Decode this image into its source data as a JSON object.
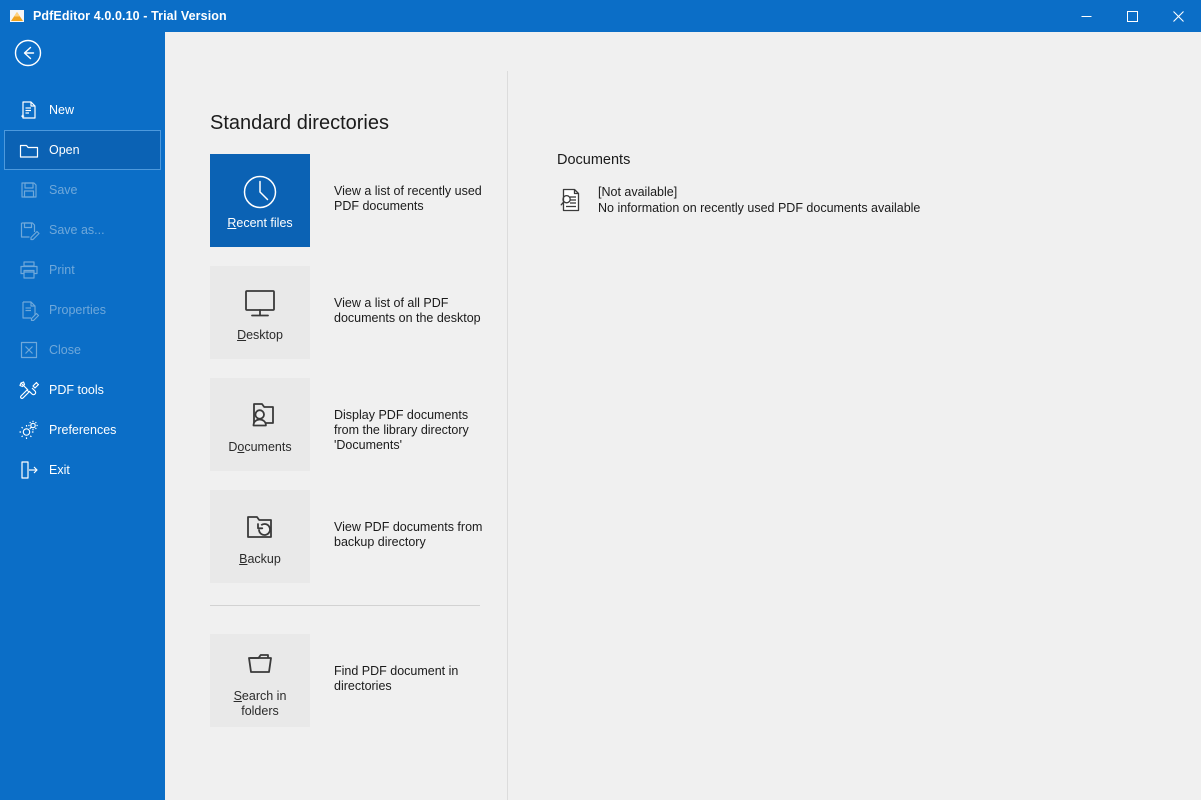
{
  "window": {
    "title": "PdfEditor 4.0.0.10 - Trial Version",
    "app_icon": "pdfeditor-logo-icon",
    "accent_color": "#0b6ec7",
    "controls": [
      {
        "name": "minimize-button",
        "glyph": "—"
      },
      {
        "name": "maximize-button",
        "glyph": "□"
      },
      {
        "name": "close-button",
        "glyph": "✕"
      }
    ]
  },
  "sidebar": {
    "back_label": "Back",
    "back_icon": "back-arrow-circle-icon",
    "items": [
      {
        "label": "New",
        "icon": "new-document-icon",
        "state": "enabled"
      },
      {
        "label": "Open",
        "icon": "open-folder-icon",
        "state": "selected"
      },
      {
        "label": "Save",
        "icon": "save-disk-icon",
        "state": "disabled"
      },
      {
        "label": "Save as...",
        "icon": "save-as-icon",
        "state": "disabled"
      },
      {
        "label": "Print",
        "icon": "printer-icon",
        "state": "disabled"
      },
      {
        "label": "Properties",
        "icon": "properties-icon",
        "state": "disabled"
      },
      {
        "label": "Close",
        "icon": "close-box-icon",
        "state": "disabled"
      },
      {
        "label": "PDF tools",
        "icon": "tools-icon",
        "state": "enabled"
      },
      {
        "label": "Preferences",
        "icon": "gears-icon",
        "state": "enabled"
      },
      {
        "label": "Exit",
        "icon": "exit-door-icon",
        "state": "enabled"
      }
    ]
  },
  "main": {
    "heading": "Standard directories",
    "tiles": [
      {
        "label": "Recent files",
        "accel": "R",
        "icon": "clock-icon",
        "selected": true,
        "description": "View a list of recently used\nPDF documents"
      },
      {
        "label": "Desktop",
        "accel": "D",
        "icon": "monitor-icon",
        "selected": false,
        "description": "View a list of all PDF\ndocuments on the desktop"
      },
      {
        "label": "Documents",
        "accel": "o",
        "icon": "folder-user-icon",
        "selected": false,
        "description": "Display PDF documents\nfrom the library directory\n'Documents'"
      },
      {
        "label": "Backup",
        "accel": "B",
        "icon": "folder-restore-icon",
        "selected": false,
        "description": "View PDF documents from\nbackup directory"
      },
      {
        "label": "Search in\nfolders",
        "accel": "S",
        "icon": "open-folder-search-icon",
        "selected": false,
        "description": "Find PDF document in\ndirectories"
      }
    ]
  },
  "details": {
    "heading": "Documents",
    "entry": {
      "icon": "document-search-icon",
      "title": "[Not available]",
      "subtitle": "No information on recently used PDF documents available"
    }
  }
}
